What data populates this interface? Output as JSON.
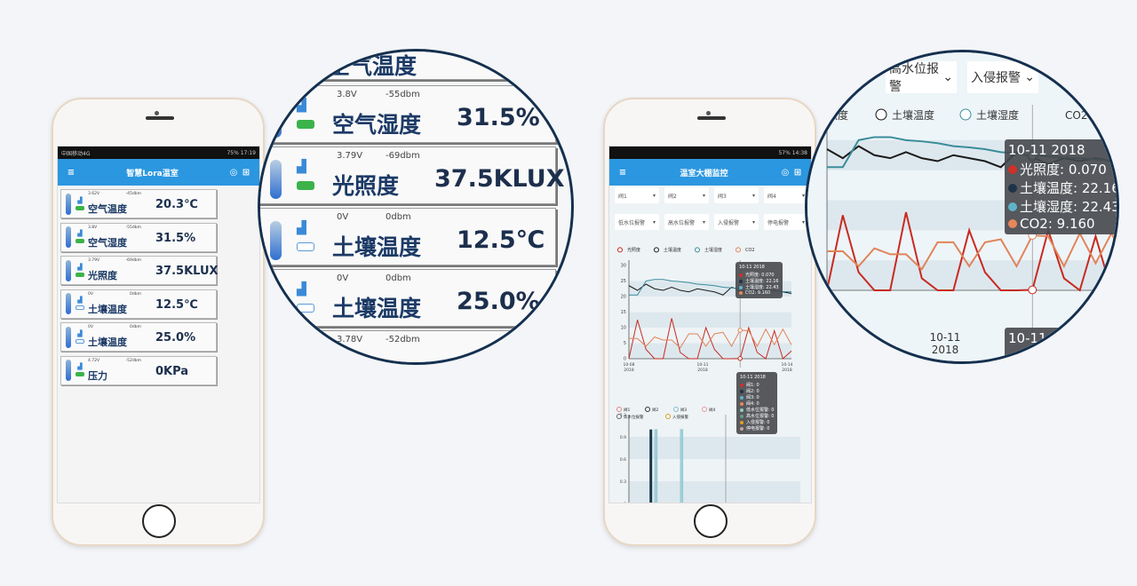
{
  "left_app": {
    "status_left": "中国移动4G",
    "status_right": "75% 17:19",
    "title": "智慧Lora温室",
    "icons": [
      "menu-icon",
      "target-icon",
      "grid-icon"
    ],
    "sensors": [
      {
        "voltage": "3.62V",
        "signal": "-45dbm",
        "label": "空气温度",
        "value": "20.3℃",
        "battery": "full"
      },
      {
        "voltage": "3.8V",
        "signal": "-55dbm",
        "label": "空气湿度",
        "value": "31.5%",
        "battery": "full"
      },
      {
        "voltage": "3.79V",
        "signal": "-69dbm",
        "label": "光照度",
        "value": "37.5KLUX",
        "battery": "full"
      },
      {
        "voltage": "0V",
        "signal": "0dbm",
        "label": "土壤温度",
        "value": "12.5℃",
        "battery": "empty"
      },
      {
        "voltage": "0V",
        "signal": "0dbm",
        "label": "土壤温度",
        "value": "25.0%",
        "battery": "empty"
      },
      {
        "voltage": "4.72V",
        "signal": "-52dbm",
        "label": "压力",
        "value": "0KPa",
        "battery": "full"
      }
    ],
    "magnifier_top_label": "空气温度",
    "magnifier_bottom_meta": {
      "voltage": "3.78V",
      "signal": "-52dbm"
    }
  },
  "right_app": {
    "status_right": "57% 14:38",
    "title": "温室大棚监控",
    "selects_row1": [
      "阀1",
      "阀2",
      "阀3",
      "阀4"
    ],
    "selects_row2": [
      "低水位报警",
      "高水位报警",
      "入侵报警",
      "停电报警"
    ],
    "chart1": {
      "legend": [
        "光照度",
        "土壤温度",
        "土壤湿度",
        "CO2"
      ],
      "y_ticks": [
        "30",
        "25",
        "20",
        "15",
        "10",
        "5",
        "0"
      ],
      "x_ticks": [
        [
          "10-08",
          "2018"
        ],
        [
          "10-11",
          "2018"
        ],
        [
          "10-14",
          "2018"
        ]
      ],
      "tooltip": {
        "title": "10-11 2018",
        "rows": [
          {
            "label": "光照度: 0.070",
            "color": "#d0302a"
          },
          {
            "label": "土壤温度: 22.16",
            "color": "#1f3347"
          },
          {
            "label": "土壤湿度: 22.43",
            "color": "#5fb3c8"
          },
          {
            "label": "CO2: 9.160",
            "color": "#e8875a"
          }
        ]
      },
      "series": [
        {
          "name": "土壤温度",
          "color": "#1b1b1b",
          "values": [
            23.5,
            22,
            24,
            22.5,
            22,
            23,
            22,
            21.5,
            22.5,
            22,
            21.5,
            20.5,
            23,
            22.16,
            21,
            22,
            21.5,
            22,
            21.5,
            21
          ]
        },
        {
          "name": "土壤湿度",
          "color": "#3a8d9a",
          "values": [
            20.5,
            20.5,
            25,
            25.5,
            25.5,
            25,
            24.8,
            24.5,
            24,
            23.8,
            23.5,
            23,
            22.8,
            22.43,
            22.3,
            22.1,
            22,
            21.8,
            21.6,
            21.5
          ]
        },
        {
          "name": "光照度",
          "color": "#c82a20",
          "values": [
            0,
            12.5,
            3,
            0,
            0,
            13,
            2,
            0,
            0,
            10,
            3,
            0,
            0,
            0.07,
            10,
            2,
            0,
            9,
            0,
            2.5
          ]
        },
        {
          "name": "CO2",
          "color": "#e0845a",
          "values": [
            6.5,
            6.5,
            4,
            7,
            6,
            6,
            3.5,
            8,
            8,
            4,
            8,
            8.5,
            4,
            9.16,
            9,
            4,
            9.5,
            4.5,
            9.5,
            4.5
          ]
        }
      ],
      "y_range": [
        0,
        30
      ]
    },
    "chart2": {
      "legend": [
        "阀1",
        "阀2",
        "阀3",
        "阀4",
        "高水位报警",
        "入侵报警"
      ],
      "y_ticks": [
        "1.2",
        "0.9",
        "0.6",
        "0.3",
        "0"
      ],
      "x_ticks": [
        "10-08",
        "10-11",
        "10-14"
      ],
      "tooltip": {
        "title": "10-11 2018",
        "rows": [
          {
            "label": "阀1: 0",
            "color": "#d0302a"
          },
          {
            "label": "阀2: 0",
            "color": "#1f3347"
          },
          {
            "label": "阀3: 0",
            "color": "#5fb3c8"
          },
          {
            "label": "阀4: 0",
            "color": "#e8875a"
          },
          {
            "label": "低水位报警: 0",
            "color": "#8fd0c0"
          },
          {
            "label": "高水位报警: 0",
            "color": "#6a9a8a"
          },
          {
            "label": "入侵报警: 0",
            "color": "#e0a020"
          },
          {
            "label": "停电报警: 0",
            "color": "#c8a0a0"
          }
        ]
      },
      "bars": [
        {
          "x": 0.12,
          "value": 1,
          "color": "#1f3347"
        },
        {
          "x": 0.15,
          "value": 1,
          "color": "#9fd0dc"
        },
        {
          "x": 0.3,
          "value": 1,
          "color": "#9fd0dc"
        }
      ]
    },
    "magnifier_selects": [
      "高水位报警",
      "入侵报警"
    ],
    "magnifier_x_label": [
      "10-11",
      "2018"
    ]
  }
}
